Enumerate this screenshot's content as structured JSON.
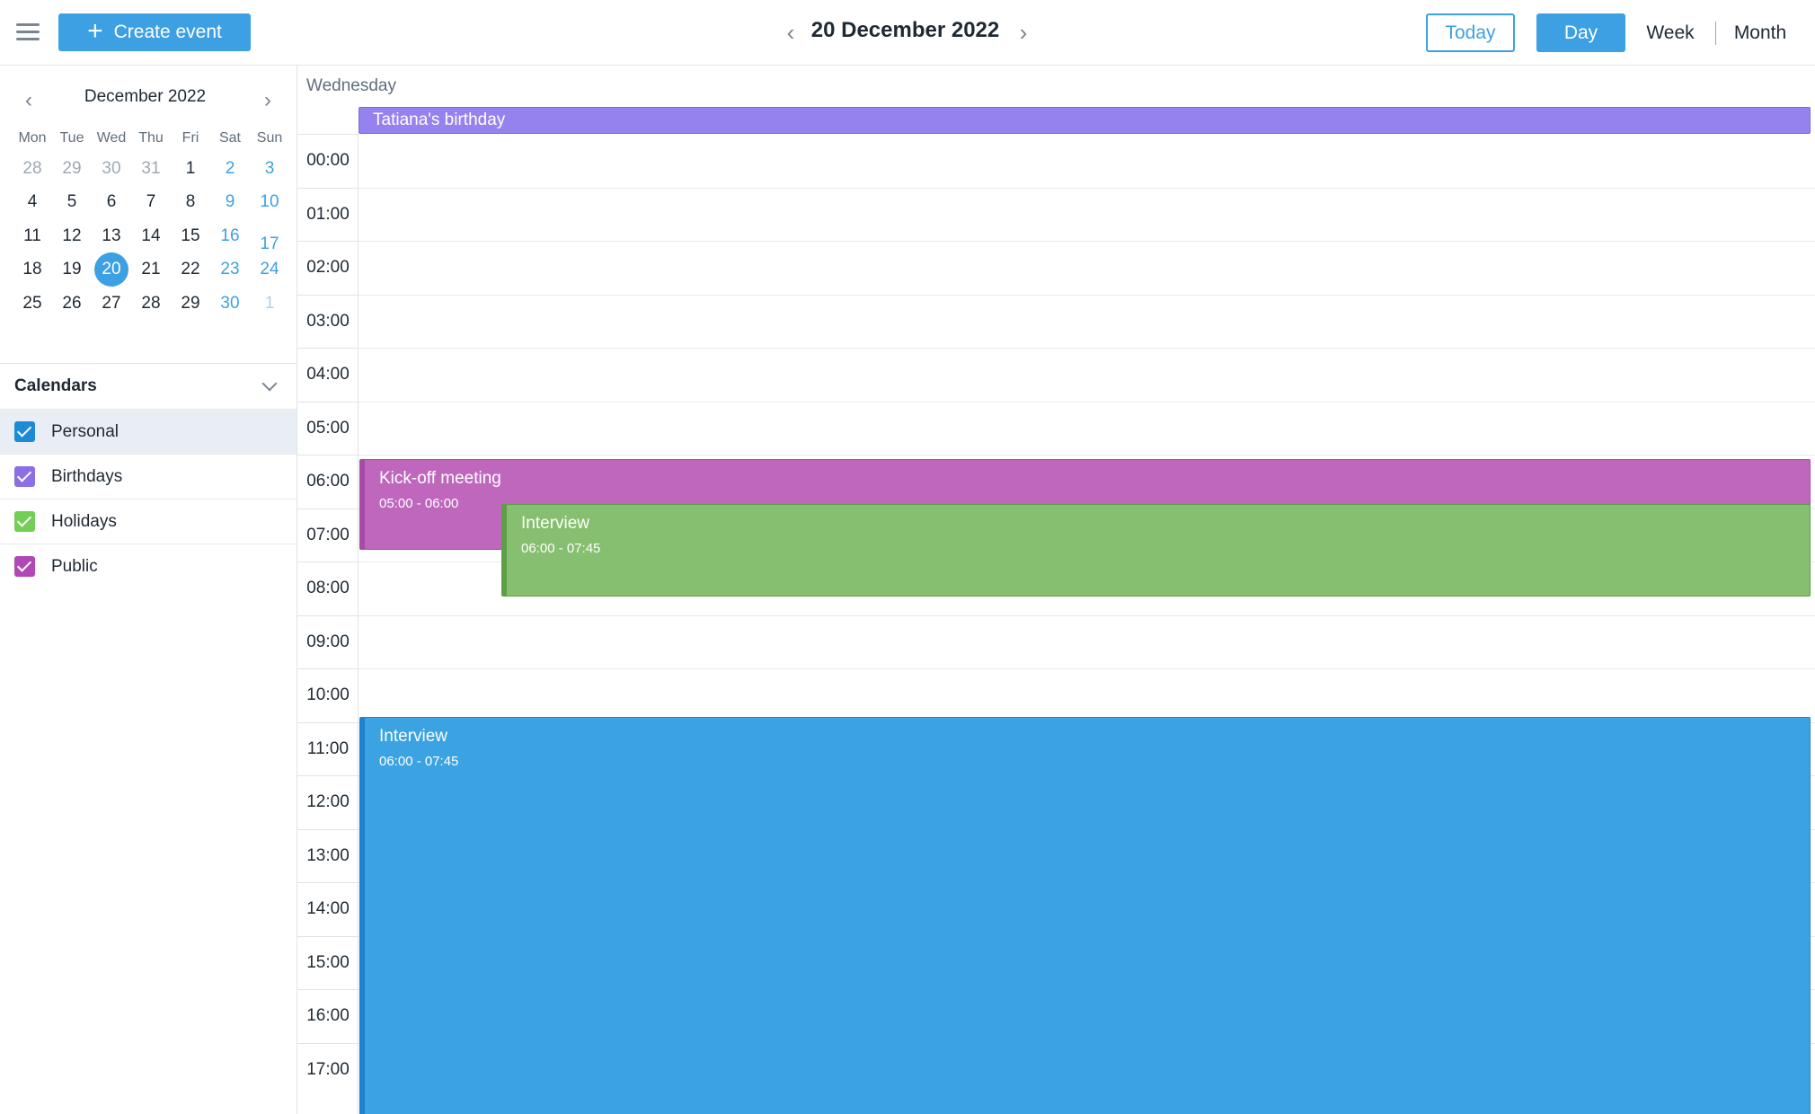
{
  "header": {
    "create_label": "Create event",
    "current_date": "20 December 2022",
    "today_label": "Today",
    "views": [
      "Day",
      "Week",
      "Month"
    ],
    "active_view": "Day"
  },
  "mini_calendar": {
    "title": "December 2022",
    "weekdays": [
      "Mon",
      "Tue",
      "Wed",
      "Thu",
      "Fri",
      "Sat",
      "Sun"
    ],
    "weeks": [
      [
        "28",
        "29",
        "30",
        "31",
        "1",
        "2",
        "3"
      ],
      [
        "4",
        "5",
        "6",
        "7",
        "8",
        "9",
        "10"
      ],
      [
        "11",
        "12",
        "13",
        "14",
        "15",
        "16",
        "17"
      ],
      [
        "18",
        "19",
        "20",
        "21",
        "22",
        "23",
        "24"
      ],
      [
        "25",
        "26",
        "27",
        "28",
        "29",
        "30",
        "1"
      ]
    ],
    "selected_day": "20"
  },
  "calendars": {
    "title": "Calendars",
    "items": [
      {
        "label": "Personal",
        "color": "#1d8ad9"
      },
      {
        "label": "Birthdays",
        "color": "#8b6fe6"
      },
      {
        "label": "Holidays",
        "color": "#72cf55"
      },
      {
        "label": "Public",
        "color": "#b048b8"
      }
    ]
  },
  "day_view": {
    "day_name": "Wednesday",
    "hours": [
      "00:00",
      "01:00",
      "02:00",
      "03:00",
      "04:00",
      "05:00",
      "06:00",
      "07:00",
      "08:00",
      "09:00",
      "10:00",
      "11:00",
      "12:00",
      "13:00",
      "14:00",
      "15:00",
      "16:00",
      "17:00"
    ],
    "all_day_event": {
      "title": "Tatiana's birthday",
      "color": "#9582ef"
    },
    "events": [
      {
        "title": "Kick-off meeting",
        "time": "05:00 - 06:00",
        "color": "#bf67bd",
        "border": "#a84ba6"
      },
      {
        "title": "Interview",
        "time": "06:00 - 07:45",
        "color": "#86bf6f",
        "border": "#5e9e46"
      },
      {
        "title": "Interview",
        "time": "06:00 - 07:45",
        "color": "#3ca3e3",
        "border": "#1e82cf"
      }
    ]
  }
}
